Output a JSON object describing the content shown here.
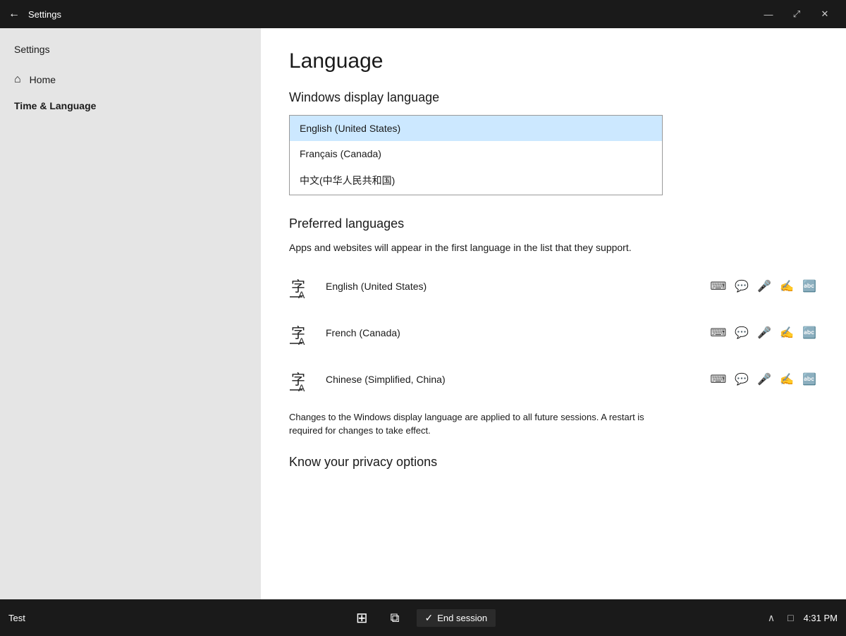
{
  "titlebar": {
    "title": "Settings",
    "back_label": "←",
    "minimize_icon": "—",
    "maximize_icon": "⤢",
    "close_icon": "✕"
  },
  "sidebar": {
    "heading": "Settings",
    "home_label": "Home",
    "active_item": "Time & Language",
    "home_icon": "⌂"
  },
  "content": {
    "page_title": "Language",
    "display_language_section": "Windows display language",
    "dropdown_options": [
      {
        "label": "English (United States)",
        "selected": true
      },
      {
        "label": "Français (Canada)",
        "selected": false
      },
      {
        "label": "中文(中华人民共和国)",
        "selected": false
      }
    ],
    "preferred_section": "Preferred languages",
    "preferred_subtitle": "Apps and websites will appear in the first language in the list that they support.",
    "languages": [
      {
        "name": "English (United States)"
      },
      {
        "name": "French (Canada)"
      },
      {
        "name": "Chinese (Simplified, China)"
      }
    ],
    "privacy_note": "Changes to the Windows display language are applied to all future sessions. A restart is required for changes to take effect.",
    "privacy_section": "Know your privacy options"
  },
  "taskbar": {
    "left_label": "Test",
    "win_icon": "⊞",
    "task_view_icon": "⧉",
    "session_icon": "✓",
    "session_label": "End session",
    "chevron_up": "∧",
    "notification_icon": "⬜",
    "time": "4:31 PM"
  }
}
